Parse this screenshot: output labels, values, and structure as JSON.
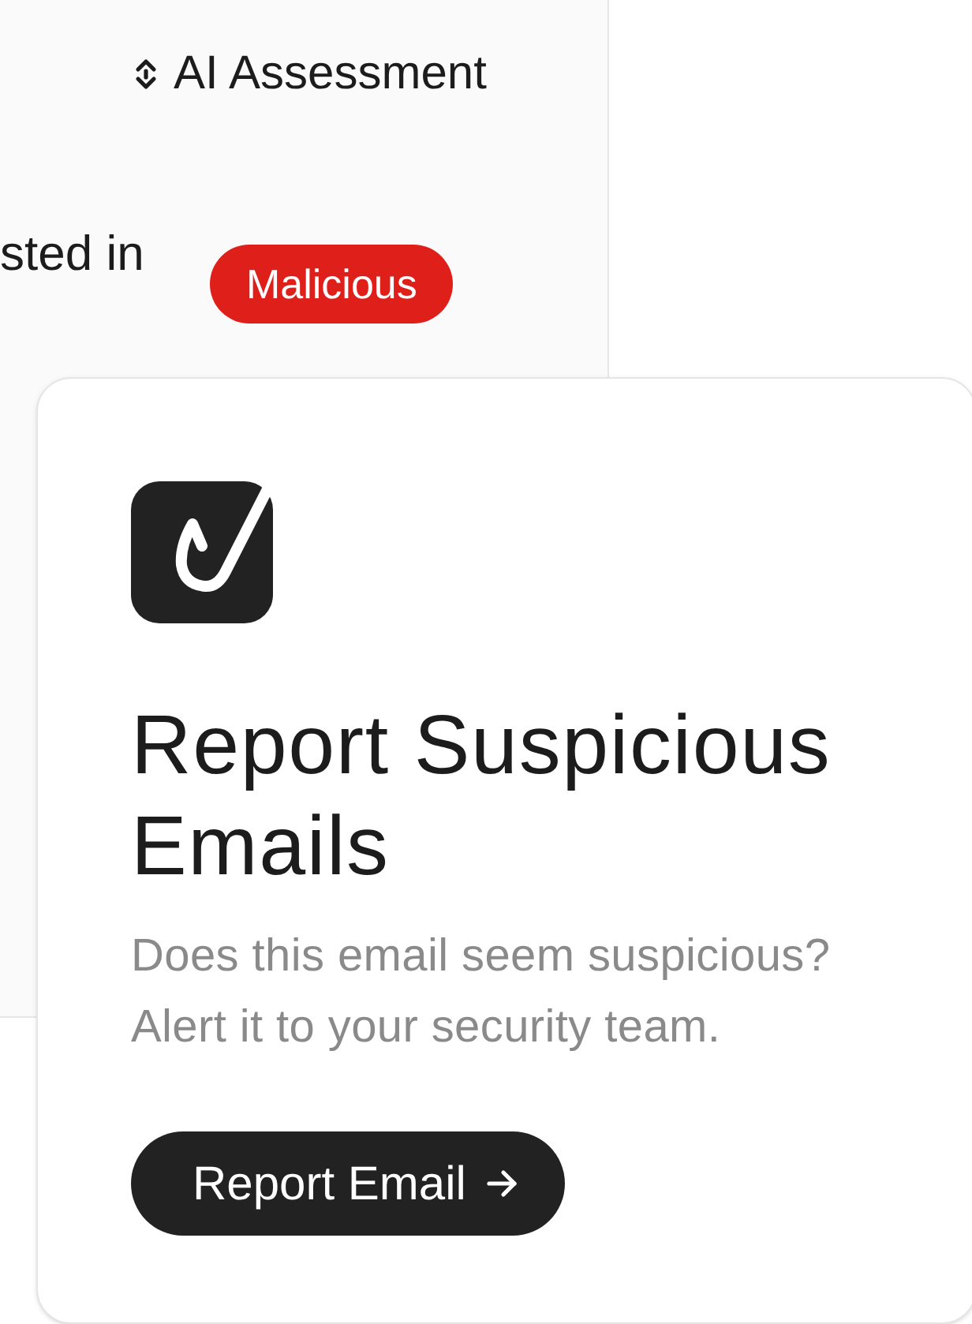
{
  "table": {
    "columns": [
      {
        "label": "AI Assessment",
        "sortable": true
      }
    ],
    "rows": [
      {
        "cells": [
          "sted in"
        ],
        "assessment": {
          "label": "Malicious",
          "color": "#df1f1a"
        }
      }
    ]
  },
  "card": {
    "title": "Report Suspicious Emails",
    "description": "Does this email seem suspicious? Alert it to your security team.",
    "button": {
      "label": "Report Email"
    }
  }
}
